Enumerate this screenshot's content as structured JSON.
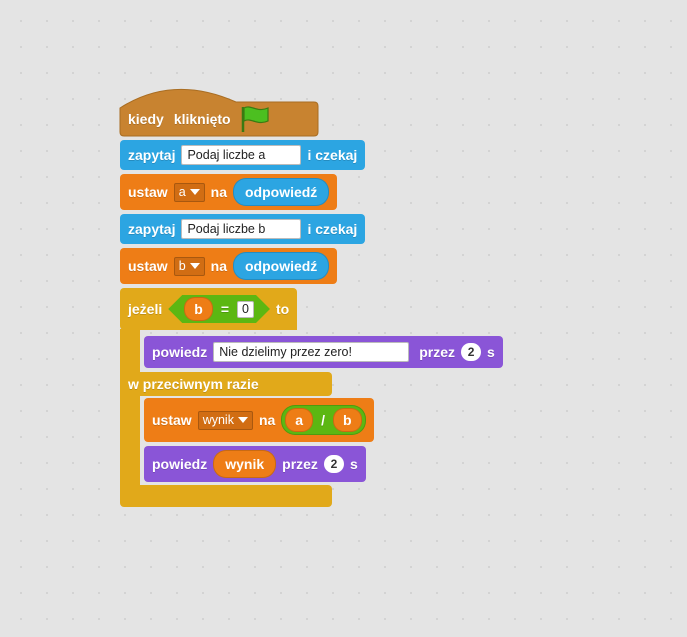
{
  "colors": {
    "events": "#c88330",
    "sensing": "#2ca5e2",
    "data": "#ee7d16",
    "operators": "#5cb712",
    "looks": "#8a55d7",
    "control": "#e1a91a"
  },
  "hat": {
    "when": "kiedy",
    "clicked": "kliknięto",
    "icon": "green-flag-icon"
  },
  "ask_a": {
    "verb": "zapytaj",
    "prompt": "Podaj liczbe a",
    "wait": "i czekaj"
  },
  "set_a": {
    "verb": "ustaw",
    "var": "a",
    "to": "na",
    "value": "odpowiedź"
  },
  "ask_b": {
    "verb": "zapytaj",
    "prompt": "Podaj liczbe b",
    "wait": "i czekaj"
  },
  "set_b": {
    "verb": "ustaw",
    "var": "b",
    "to": "na",
    "value": "odpowiedź"
  },
  "if_else": {
    "if": "jeżeli",
    "cond_left": "b",
    "cond_op": "=",
    "cond_right": "0",
    "then": "to",
    "else": "w przeciwnym razie"
  },
  "say_zero": {
    "verb": "powiedz",
    "message": "Nie dzielimy przez zero!",
    "for": "przez",
    "secs": "2",
    "unit": "s"
  },
  "set_result": {
    "verb": "ustaw",
    "var": "wynik",
    "to": "na",
    "left": "a",
    "op": "/",
    "right": "b"
  },
  "say_result": {
    "verb": "powiedz",
    "message": "wynik",
    "for": "przez",
    "secs": "2",
    "unit": "s"
  }
}
